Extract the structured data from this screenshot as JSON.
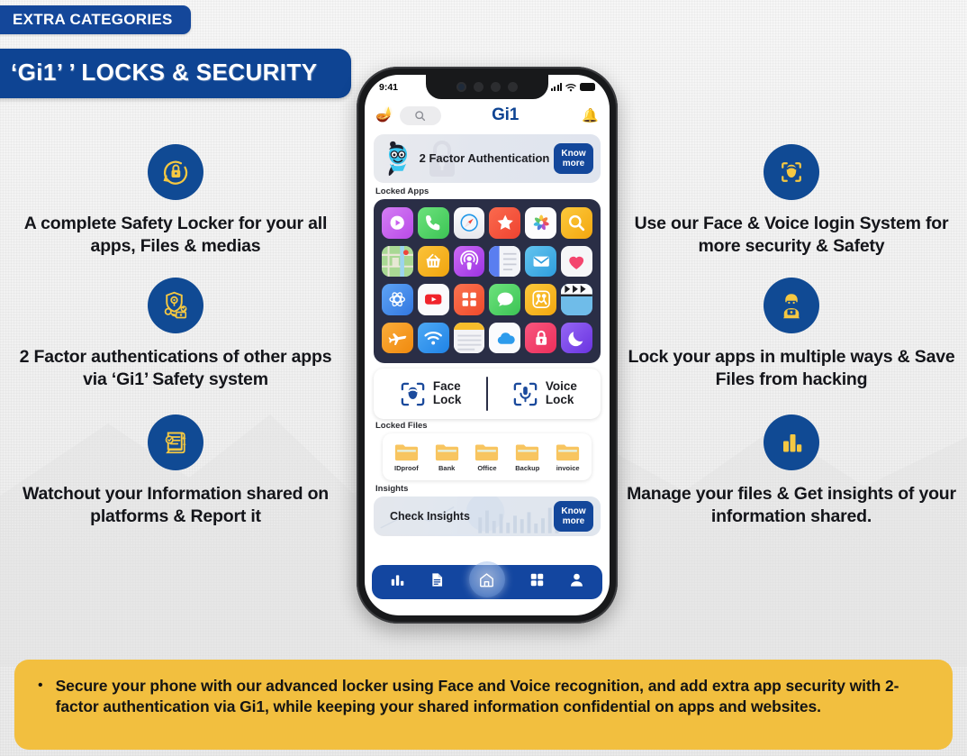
{
  "colors": {
    "brand_blue": "#104a94",
    "banner_blue": "#0e4493",
    "accent_yellow": "#f2bf3f",
    "icon_yellow": "#f5c842",
    "nav_blue": "#1346a0"
  },
  "header": {
    "category_label": "EXTRA CATEGORIES",
    "title": "‘Gi1’ ’ LOCKS & SECURITY"
  },
  "left_features": [
    {
      "icon": "lock-shield-icon",
      "text": "A complete Safety Locker for your all apps, Files & medias"
    },
    {
      "icon": "shield-key-money-icon",
      "text": "2 Factor authentications of other apps via ‘Gi1’ Safety system"
    },
    {
      "icon": "document-report-icon",
      "text": "Watchout your Information shared on platforms & Report it"
    }
  ],
  "right_features": [
    {
      "icon": "face-scan-icon",
      "text": "Use our Face & Voice login System for more security & Safety"
    },
    {
      "icon": "hacker-laptop-icon",
      "text": "Lock your apps in multiple ways & Save Files from hacking"
    },
    {
      "icon": "bar-chart-icon",
      "text": "Manage your files & Get insights of your information shared."
    }
  ],
  "phone": {
    "status": {
      "time": "9:41",
      "signal_icon": "cellular-bars-icon",
      "wifi_icon": "wifi-icon",
      "battery_icon": "battery-icon"
    },
    "app_header": {
      "lamp_icon": "genie-lamp-icon",
      "search_icon": "search-icon",
      "brand": "Gi1",
      "bell_icon": "bell-icon"
    },
    "promo": {
      "title": "2 Factor Authentication",
      "button_line1": "Know",
      "button_line2": "more",
      "mascot": "genie-mascot-icon"
    },
    "locked_apps_label": "Locked Apps",
    "apps": [
      {
        "name": "media-player-app",
        "bg": "#c95ff0",
        "glyph": "play-circle"
      },
      {
        "name": "phone-app",
        "bg": "#4cd062",
        "glyph": "phone"
      },
      {
        "name": "safari-app",
        "bg": "#f0f0f2",
        "glyph": "compass"
      },
      {
        "name": "favorites-app",
        "bg": "#f4533c",
        "glyph": "star"
      },
      {
        "name": "photos-app",
        "bg": "#fbfbfb",
        "glyph": "pinwheel"
      },
      {
        "name": "search-app",
        "bg": "#f7b41c",
        "glyph": "magnifier"
      },
      {
        "name": "maps-app",
        "bg": "#8fd07a",
        "glyph": "map"
      },
      {
        "name": "shopping-app",
        "bg": "#f6b91b",
        "glyph": "basket"
      },
      {
        "name": "podcasts-app",
        "bg": "#b84df0",
        "glyph": "podcast"
      },
      {
        "name": "notes-app",
        "bg": "#edeef2",
        "glyph": "pages"
      },
      {
        "name": "mail-app",
        "bg": "#46b3e6",
        "glyph": "envelope"
      },
      {
        "name": "health-app",
        "bg": "#f4f4f6",
        "glyph": "heart"
      },
      {
        "name": "atom-app",
        "bg": "#3f8ef0",
        "glyph": "atom"
      },
      {
        "name": "youtube-app",
        "bg": "#f6f6f8",
        "glyph": "youtube"
      },
      {
        "name": "apps-grid-app",
        "bg": "#f4603a",
        "glyph": "grid"
      },
      {
        "name": "messages-app",
        "bg": "#4cd062",
        "glyph": "chat"
      },
      {
        "name": "family-app",
        "bg": "#f7bb1b",
        "glyph": "people"
      },
      {
        "name": "video-app",
        "bg": "#64b9e8",
        "glyph": "clapper"
      },
      {
        "name": "travel-app",
        "bg": "#f6991a",
        "glyph": "plane"
      },
      {
        "name": "wifi-app",
        "bg": "#2f97f0",
        "glyph": "wifi"
      },
      {
        "name": "reminders-app",
        "bg": "#efeff1",
        "glyph": "lines"
      },
      {
        "name": "icloud-app",
        "bg": "#f6f7f9",
        "glyph": "cloud"
      },
      {
        "name": "privacy-app",
        "bg": "#f4456e",
        "glyph": "padlock"
      },
      {
        "name": "sleep-app",
        "bg": "#7b4df0",
        "glyph": "moon"
      }
    ],
    "locks": [
      {
        "icon": "face-lock-icon",
        "line1": "Face",
        "line2": "Lock"
      },
      {
        "icon": "voice-lock-icon",
        "line1": "Voice",
        "line2": "Lock"
      }
    ],
    "locked_files_label": "Locked Files",
    "files": [
      "IDproof",
      "Bank",
      "Office",
      "Backup",
      "invoice"
    ],
    "insights_label": "Insights",
    "insights": {
      "title": "Check Insights",
      "button_line1": "Know",
      "button_line2": "more"
    },
    "nav": [
      {
        "name": "nav-stats",
        "icon": "bar-chart-icon"
      },
      {
        "name": "nav-files",
        "icon": "document-icon"
      },
      {
        "name": "nav-home",
        "icon": "home-icon"
      },
      {
        "name": "nav-apps",
        "icon": "grid-icon"
      },
      {
        "name": "nav-profile",
        "icon": "person-icon"
      }
    ]
  },
  "footer": {
    "bullet": "•",
    "text": "Secure your phone with our advanced locker using Face and Voice recognition, and add extra app security with 2-factor authentication via Gi1, while keeping your shared information confidential on apps and websites."
  }
}
